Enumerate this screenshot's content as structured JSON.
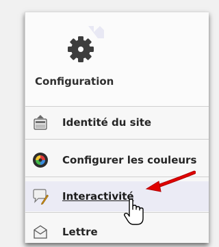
{
  "menu": {
    "title": "Configuration",
    "header_icon": "gear-icon",
    "items": [
      {
        "label": "Identité du site",
        "icon": "site-identity-icon"
      },
      {
        "label": "Configurer les couleurs",
        "icon": "color-wheel-icon"
      },
      {
        "label": "Interactivité",
        "icon": "interactivity-icon"
      },
      {
        "label": "Lettre",
        "icon": "newsletter-icon"
      }
    ]
  },
  "overlay": {
    "annotation": "red-arrow-icon",
    "pointer": "hand-cursor-icon"
  },
  "colors": {
    "background": "#f1f1f1",
    "panel": "#f7f7f7",
    "hover_row": "#ebebf5",
    "arrow": "#e00000"
  }
}
